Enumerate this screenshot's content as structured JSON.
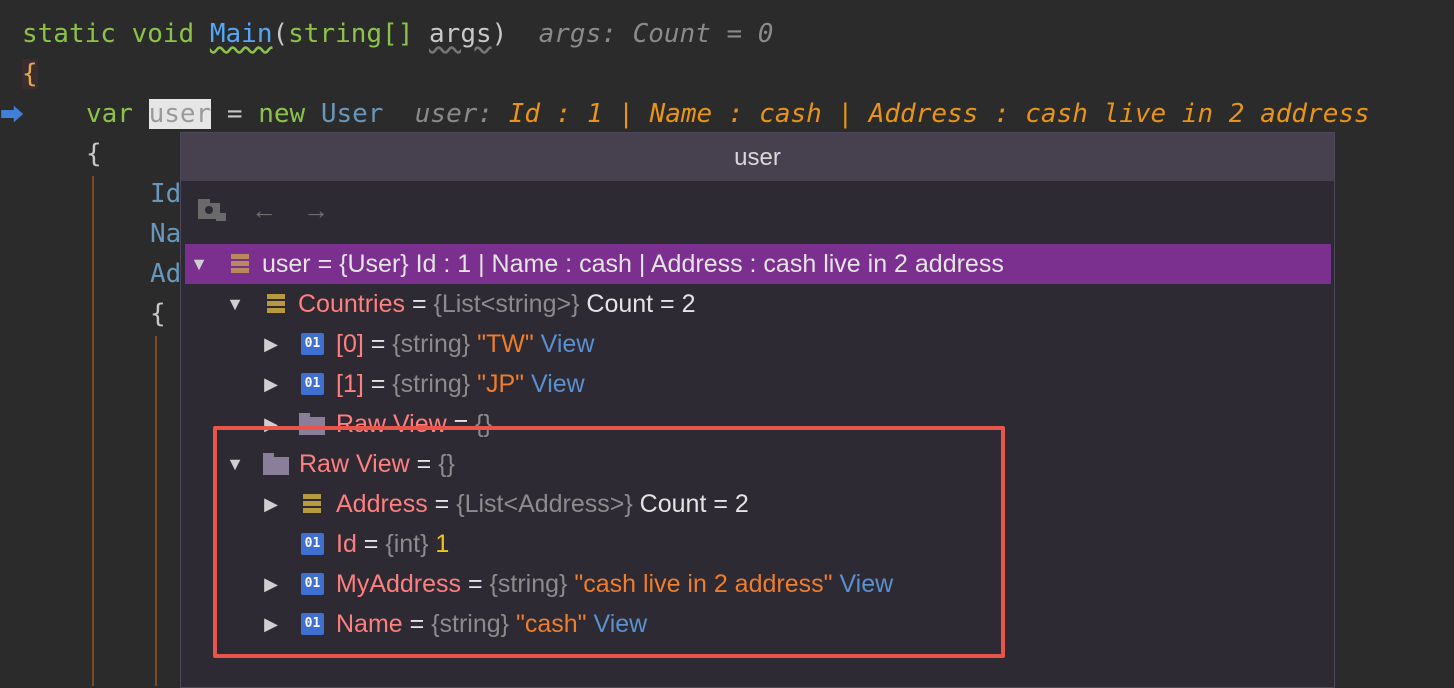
{
  "editor": {
    "line1": {
      "keyword1": "static",
      "keyword2": "void",
      "method": "Main",
      "paren_open": "(",
      "type": "string[]",
      "param": "args",
      "paren_close": ")",
      "hint_label": "args:",
      "hint_value": "Count = 0"
    },
    "line2": {
      "brace": "{"
    },
    "line3": {
      "keyword": "var",
      "selected_var": "user",
      "assign": "=",
      "keyword_new": "new",
      "type": "User",
      "hint_label": "user:",
      "hint_value": "Id : 1 | Name : cash | Address : cash live in 2 address"
    },
    "line4": {
      "brace": "{"
    },
    "line5": {
      "text": "Id"
    },
    "line6": {
      "text": "Na"
    },
    "line7": {
      "text": "Ad"
    },
    "line8": {
      "brace": "{"
    }
  },
  "popup": {
    "title": "user",
    "toolbar": {
      "icon1": "pin-folder-icon",
      "icon2": "back-arrow-icon",
      "icon3": "forward-arrow-icon",
      "back": "←",
      "forward": "→"
    },
    "tree": [
      {
        "arrow": "▼",
        "icon": "list-icon",
        "name": "user",
        "eq": " = ",
        "type": "{User}",
        "value": " Id : 1 | Name : cash | Address : cash live in 2 address"
      },
      {
        "arrow": "▼",
        "icon": "list-icon",
        "name": "Countries",
        "eq": " = ",
        "type": "{List<string>}",
        "value": " Count = 2"
      },
      {
        "arrow": "▶",
        "icon": "primitive-icon",
        "name": "[0]",
        "eq": " = ",
        "type": "{string}",
        "value": " \"TW\"",
        "link": "View"
      },
      {
        "arrow": "▶",
        "icon": "primitive-icon",
        "name": "[1]",
        "eq": " = ",
        "type": "{string}",
        "value": " \"JP\"",
        "link": "View"
      },
      {
        "arrow": "▶",
        "icon": "folder-icon",
        "name": "Raw View",
        "eq": " = ",
        "type": "{}"
      },
      {
        "arrow": "▼",
        "icon": "folder-icon",
        "name": "Raw View",
        "eq": " = ",
        "type": "{}"
      },
      {
        "arrow": "▶",
        "icon": "list-icon",
        "name": "Address",
        "eq": " = ",
        "type": "{List<Address>}",
        "value": " Count = 2"
      },
      {
        "arrow": "",
        "icon": "primitive-icon",
        "name": "Id",
        "eq": " = ",
        "type": "{int}",
        "value": " 1"
      },
      {
        "arrow": "▶",
        "icon": "primitive-icon",
        "name": "MyAddress",
        "eq": " = ",
        "type": "{string}",
        "value": " \"cash live in 2 address\"",
        "link": "View"
      },
      {
        "arrow": "▶",
        "icon": "primitive-icon",
        "name": "Name",
        "eq": " = ",
        "type": "{string}",
        "value": " \"cash\"",
        "link": "View"
      }
    ],
    "primitive_icon_label": "01"
  },
  "colors": {
    "editor_bg": "#2b2b2b",
    "popup_bg": "#2d2a34",
    "selected_row": "#7b2f8e",
    "highlight_box": "#e8564b",
    "string": "#ef7d2c",
    "link": "#5a8fd0"
  }
}
